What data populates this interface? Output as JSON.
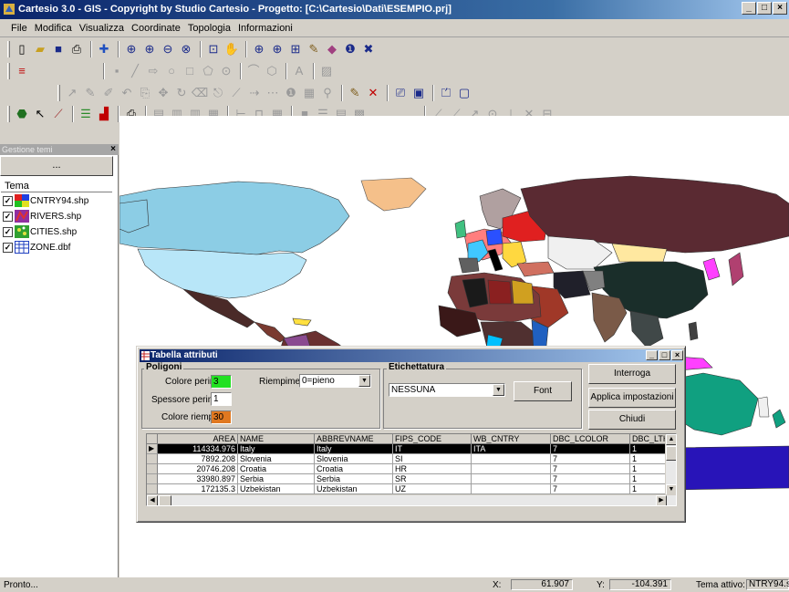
{
  "window": {
    "title": "Cartesio 3.0  - GIS - Copyright by Studio Cartesio - Progetto: [C:\\Cartesio\\Dati\\ESEMPIO.prj]",
    "min": "_",
    "max": "□",
    "close": "×"
  },
  "menu": [
    "File",
    "Modifica",
    "Visualizza",
    "Coordinate",
    "Topologia",
    "Informazioni"
  ],
  "left_panel": {
    "header": "Gestione temi",
    "close": "×",
    "dots_button": "...",
    "column_header": "Tema",
    "layers": [
      {
        "name": "CNTRY94.shp",
        "checked": "✓",
        "icon": "polygon-layer-icon"
      },
      {
        "name": "RIVERS.shp",
        "checked": "✓",
        "icon": "line-layer-icon"
      },
      {
        "name": "CITIES.shp",
        "checked": "✓",
        "icon": "point-layer-icon"
      },
      {
        "name": "ZONE.dbf",
        "checked": "✓",
        "icon": "table-layer-icon"
      }
    ]
  },
  "dialog": {
    "title": "Tabella attributi",
    "min": "_",
    "max": "□",
    "close": "×",
    "poligoni": {
      "label": "Poligoni",
      "colore_perim_label": "Colore perim.",
      "colore_perim_value": "3",
      "colore_perim_color": "#22e022",
      "spessore_label": "Spessore perim.",
      "spessore_value": "1",
      "colore_riemp_label": "Colore riemp.",
      "colore_riemp_value": "30",
      "colore_riemp_color": "#e07820",
      "riempimento_label": "Riempimento",
      "riempimento_value": "0=pieno"
    },
    "etichettatura": {
      "label": "Etichettatura",
      "value": "NESSUNA",
      "font_button": "Font"
    },
    "buttons": {
      "interroga": "Interroga",
      "applica": "Applica impostazioni",
      "chiudi": "Chiudi"
    },
    "table": {
      "columns": [
        "AREA",
        "NAME",
        "ABBREVNAME",
        "FIPS_CODE",
        "WB_CNTRY",
        "DBC_LCOLOR",
        "DBC_LTH"
      ],
      "rows": [
        [
          "114334.976",
          "Italy",
          "Italy",
          "IT",
          "ITA",
          "7",
          "1"
        ],
        [
          "7892.208",
          "Slovenia",
          "Slovenia",
          "SI",
          "",
          "7",
          "1"
        ],
        [
          "20746.208",
          "Croatia",
          "Croatia",
          "HR",
          "",
          "7",
          "1"
        ],
        [
          "33980.897",
          "Serbia",
          "Serbia",
          "SR",
          "",
          "7",
          "1"
        ],
        [
          "172135.3",
          "Uzbekistan",
          "Uzbekistan",
          "UZ",
          "",
          "7",
          "1"
        ]
      ],
      "selected_row": 0
    }
  },
  "status": {
    "text": "Pronto...",
    "x_label": "X:",
    "x_value": "61.907",
    "y_label": "Y:",
    "y_value": "-104.391",
    "tema_label": "Tema attivo:",
    "tema_value": "NTRY94.sh"
  }
}
